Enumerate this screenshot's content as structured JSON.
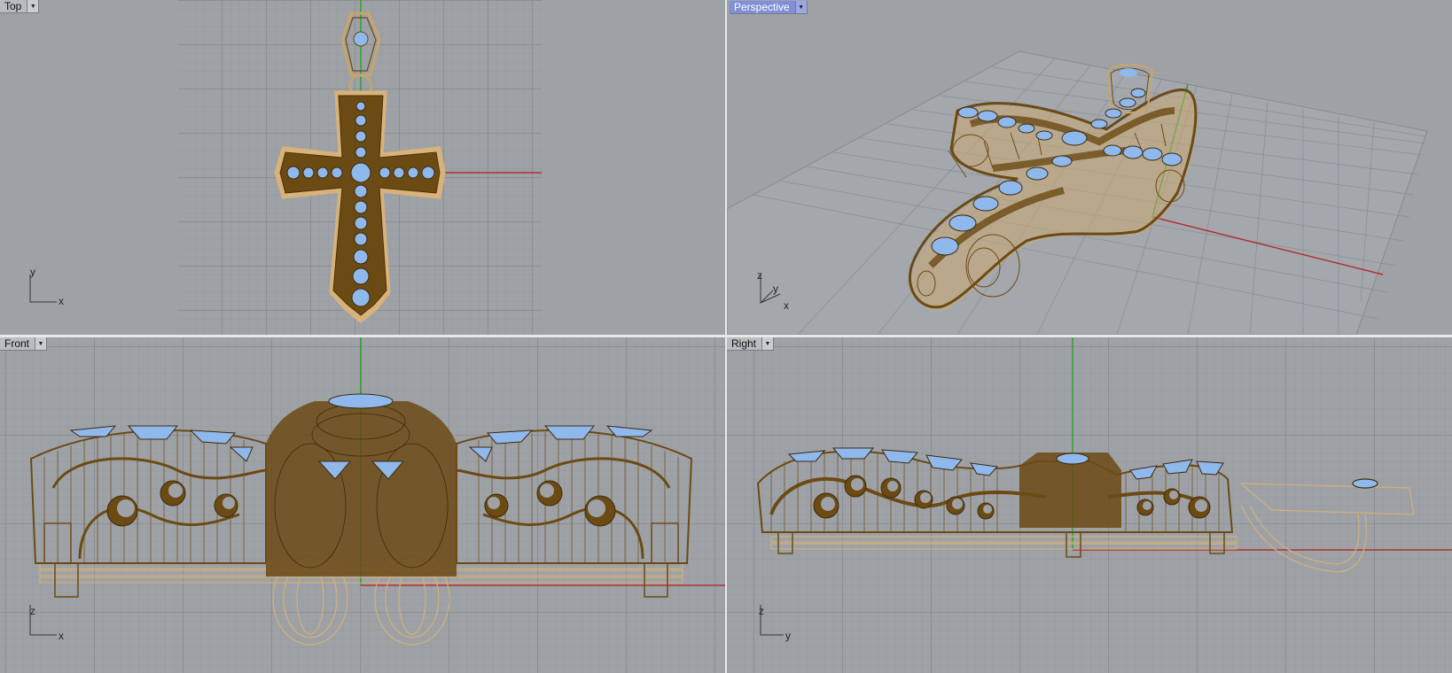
{
  "viewports": {
    "top": {
      "label": "Top",
      "axis1": "x",
      "axis2": "y"
    },
    "perspective": {
      "label": "Perspective",
      "axis1": "x",
      "axis2": "y",
      "axis3": "z"
    },
    "front": {
      "label": "Front",
      "axis1": "x",
      "axis2": "z"
    },
    "right": {
      "label": "Right",
      "axis1": "y",
      "axis2": "z"
    }
  },
  "colors": {
    "viewport_bg": "#9ea2a7",
    "grid_minor": "#8e9297",
    "grid_major": "#7c8085",
    "wire_dark": "#6b4a14",
    "wire_light": "#c9a56a",
    "gem": "#8fb8ec",
    "x_axis": "#b03030",
    "y_axis": "#30a030",
    "active_tab": "#7f8fd8"
  },
  "icons": {
    "dropdown": "dropdown-arrow-icon"
  }
}
